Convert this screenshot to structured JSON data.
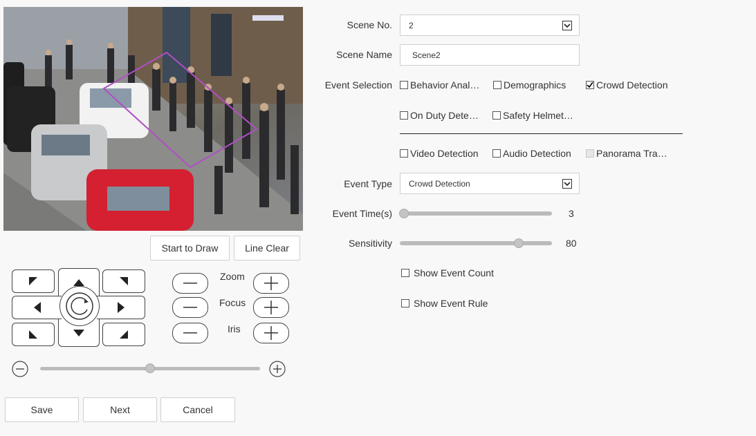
{
  "preview": {
    "draw_button": "Start to Draw",
    "clear_button": "Line Clear"
  },
  "ptz": {
    "zoom_label": "Zoom",
    "focus_label": "Focus",
    "iris_label": "Iris",
    "speed_level": 0.5
  },
  "footer": {
    "save": "Save",
    "next": "Next",
    "cancel": "Cancel"
  },
  "form": {
    "scene_no_label": "Scene No.",
    "scene_no_value": "2",
    "scene_name_label": "Scene Name",
    "scene_name_value": "Scene2",
    "event_selection_label": "Event Selection",
    "events": [
      {
        "label": "Behavior Anal…",
        "checked": false,
        "enabled": true
      },
      {
        "label": "Demographics",
        "checked": false,
        "enabled": true
      },
      {
        "label": "Crowd Detection",
        "checked": true,
        "enabled": true
      },
      {
        "label": "On Duty Dete…",
        "checked": false,
        "enabled": true
      },
      {
        "label": "Safety Helmet…",
        "checked": false,
        "enabled": true
      },
      {
        "label": "Video Detection",
        "checked": false,
        "enabled": true
      },
      {
        "label": "Audio Detection",
        "checked": false,
        "enabled": true
      },
      {
        "label": "Panorama Tra…",
        "checked": false,
        "enabled": false
      }
    ],
    "event_type_label": "Event Type",
    "event_type_value": "Crowd Detection",
    "event_time_label": "Event Time(s)",
    "event_time_value": "3",
    "event_time_level": 0.0,
    "sensitivity_label": "Sensitivity",
    "sensitivity_value": "80",
    "sensitivity_level": 0.8,
    "show_event_count": "Show Event Count",
    "show_event_rule": "Show Event Rule"
  },
  "colors": {
    "region_outline": "#b04fc4",
    "background": "#f8f8f8"
  }
}
